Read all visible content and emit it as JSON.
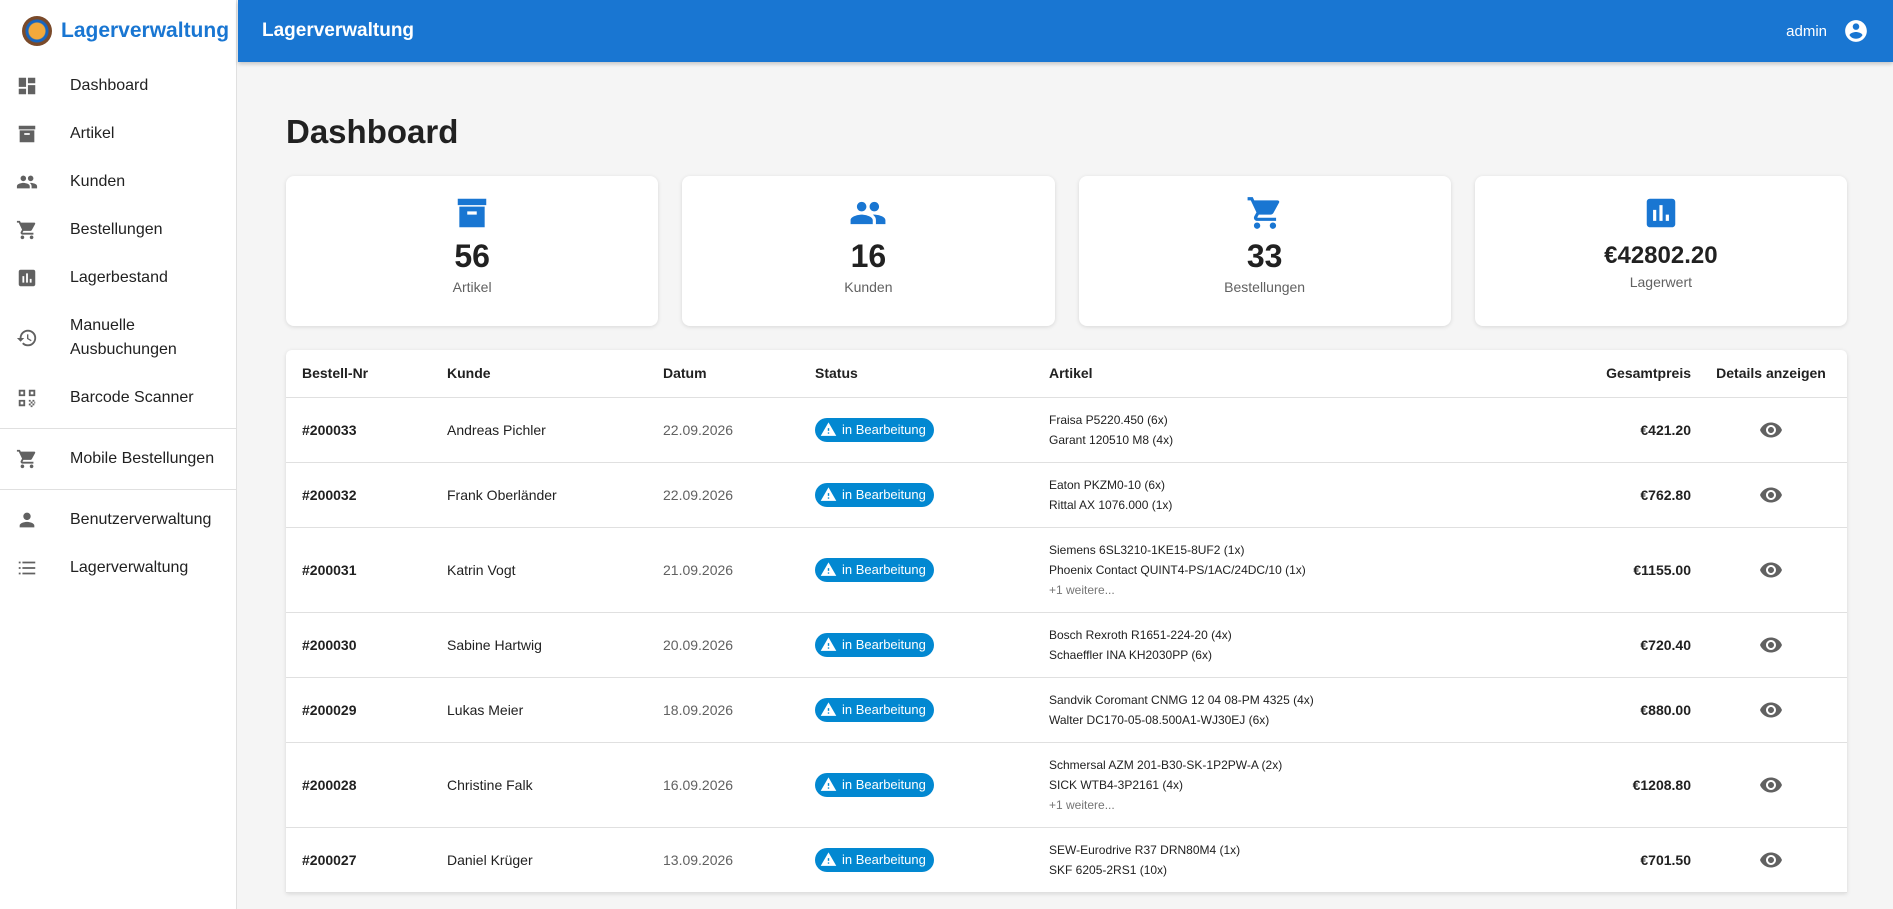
{
  "brand": {
    "title": "Lagerverwaltung"
  },
  "sidebar": {
    "items": [
      {
        "label": "Dashboard",
        "icon": "dashboard-icon"
      },
      {
        "label": "Artikel",
        "icon": "archive-icon"
      },
      {
        "label": "Kunden",
        "icon": "people-icon"
      },
      {
        "label": "Bestellungen",
        "icon": "cart-icon"
      },
      {
        "label": "Lagerbestand",
        "icon": "bar-chart-icon"
      },
      {
        "label": "Manuelle Ausbuchungen",
        "icon": "history-icon"
      },
      {
        "label": "Barcode Scanner",
        "icon": "qr-code-icon"
      },
      {
        "label": "Mobile Bestellungen",
        "icon": "cart-icon"
      },
      {
        "label": "Benutzerverwaltung",
        "icon": "person-icon"
      },
      {
        "label": "Lagerverwaltung",
        "icon": "list-icon"
      }
    ]
  },
  "header": {
    "title": "Lagerverwaltung",
    "user": "admin"
  },
  "page": {
    "title": "Dashboard"
  },
  "stats": [
    {
      "value": "56",
      "label": "Artikel",
      "icon": "archive-icon"
    },
    {
      "value": "16",
      "label": "Kunden",
      "icon": "people-icon"
    },
    {
      "value": "33",
      "label": "Bestellungen",
      "icon": "cart-icon"
    },
    {
      "value": "€42802.20",
      "label": "Lagerwert",
      "icon": "bar-chart-icon"
    }
  ],
  "table": {
    "columns": [
      "Bestell-Nr",
      "Kunde",
      "Datum",
      "Status",
      "Artikel",
      "Gesamtpreis",
      "Details anzeigen"
    ],
    "rows": [
      {
        "order": "#200033",
        "customer": "Andreas Pichler",
        "date": "22.09.2026",
        "status": "in Bearbeitung",
        "items": [
          "Fraisa P5220.450 (6x)",
          "Garant 120510 M8 (4x)"
        ],
        "more": "",
        "price": "€421.20"
      },
      {
        "order": "#200032",
        "customer": "Frank Oberländer",
        "date": "22.09.2026",
        "status": "in Bearbeitung",
        "items": [
          "Eaton PKZM0-10 (6x)",
          "Rittal AX 1076.000 (1x)"
        ],
        "more": "",
        "price": "€762.80"
      },
      {
        "order": "#200031",
        "customer": "Katrin Vogt",
        "date": "21.09.2026",
        "status": "in Bearbeitung",
        "items": [
          "Siemens 6SL3210-1KE15-8UF2 (1x)",
          "Phoenix Contact QUINT4-PS/1AC/24DC/10 (1x)"
        ],
        "more": "+1 weitere...",
        "price": "€1155.00"
      },
      {
        "order": "#200030",
        "customer": "Sabine Hartwig",
        "date": "20.09.2026",
        "status": "in Bearbeitung",
        "items": [
          "Bosch Rexroth R1651-224-20 (4x)",
          "Schaeffler INA KH2030PP (6x)"
        ],
        "more": "",
        "price": "€720.40"
      },
      {
        "order": "#200029",
        "customer": "Lukas Meier",
        "date": "18.09.2026",
        "status": "in Bearbeitung",
        "items": [
          "Sandvik Coromant CNMG 12 04 08-PM 4325 (4x)",
          "Walter DC170-05-08.500A1-WJ30EJ (6x)"
        ],
        "more": "",
        "price": "€880.00"
      },
      {
        "order": "#200028",
        "customer": "Christine Falk",
        "date": "16.09.2026",
        "status": "in Bearbeitung",
        "items": [
          "Schmersal AZM 201-B30-SK-1P2PW-A (2x)",
          "SICK WTB4-3P2161 (4x)"
        ],
        "more": "+1 weitere...",
        "price": "€1208.80"
      },
      {
        "order": "#200027",
        "customer": "Daniel Krüger",
        "date": "13.09.2026",
        "status": "in Bearbeitung",
        "items": [
          "SEW-Eurodrive R37 DRN80M4 (1x)",
          "SKF 6205-2RS1 (10x)"
        ],
        "more": "",
        "price": "€701.50"
      }
    ]
  },
  "colors": {
    "primary": "#1976d2",
    "status_info": "#0288d1"
  }
}
